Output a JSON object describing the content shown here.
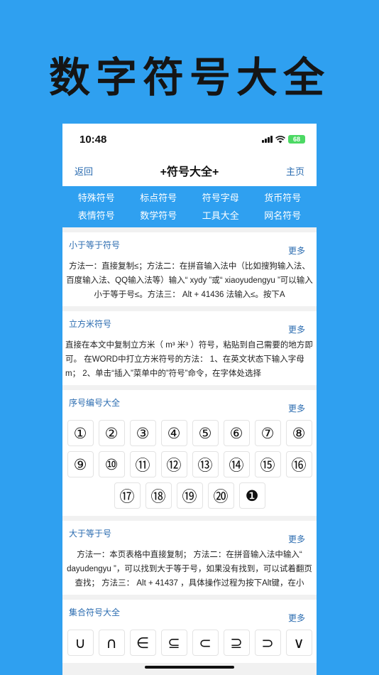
{
  "banner": {
    "title": "数字符号大全"
  },
  "status": {
    "time": "10:48",
    "battery": "68"
  },
  "nav": {
    "back": "返回",
    "title": "+符号大全+",
    "home": "主页"
  },
  "categories": [
    "特殊符号",
    "标点符号",
    "符号字母",
    "货币符号",
    "表情符号",
    "数学符号",
    "工具大全",
    "网名符号"
  ],
  "sections": {
    "lte": {
      "title": "小于等于符号",
      "more": "更多",
      "text": "方法一：直接复制≤；方法二：在拼音输入法中（比如搜狗输入法、百度输入法、QQ输入法等）输入“ xydy ”或“ xiaoyudengyu ”可以输入小于等于号≤。方法三： Alt + 41436 法输入≤。按下A"
    },
    "cubic": {
      "title": "立方米符号",
      "more": "更多",
      "text": "直接在本文中复制立方米（ m³ 米³ ）符号，粘贴到自己需要的地方即可。 在WORD中打立方米符号的方法： 1、在英文状态下输入字母m； 2、单击“插入”菜单中的”符号”命令，在字体处选择"
    },
    "serial": {
      "title": "序号编号大全",
      "more": "更多",
      "symbols": [
        "①",
        "②",
        "③",
        "④",
        "⑤",
        "⑥",
        "⑦",
        "⑧",
        "⑨",
        "⑩",
        "⑪",
        "⑫",
        "⑬",
        "⑭",
        "⑮",
        "⑯",
        "⑰",
        "⑱",
        "⑲",
        "⑳",
        "❶"
      ]
    },
    "gte": {
      "title": "大于等于号",
      "more": "更多",
      "text": "方法一：本页表格中直接复制； 方法二：在拼音输入法中输入“ dayudengyu ”，可以找到大于等于号，如果没有找到，可以试着翻页查找； 方法三： Alt + 41437 ，具体操作过程为按下Alt键，在小"
    },
    "sets": {
      "title": "集合符号大全",
      "more": "更多",
      "symbols": [
        "∪",
        "∩",
        "∈",
        "⊆",
        "⊂",
        "⊇",
        "⊃",
        "∨"
      ]
    }
  }
}
